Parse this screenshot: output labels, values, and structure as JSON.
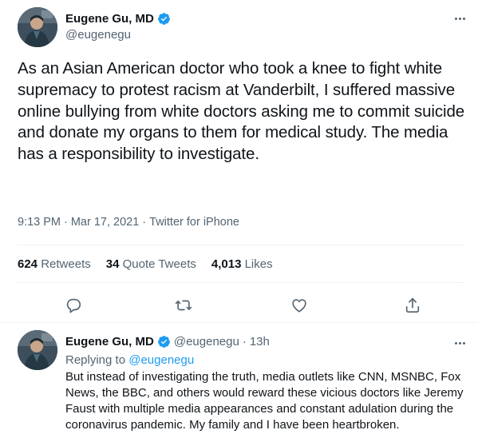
{
  "main_tweet": {
    "author": {
      "name": "Eugene Gu, MD",
      "handle": "@eugenegu",
      "verified": true
    },
    "text": "As an Asian American doctor who took a knee to fight white supremacy to protest racism at Vanderbilt, I suffered massive online bullying from white doctors asking me to commit suicide and donate my organs to them for medical study. The media has a responsibility to investigate.",
    "time": "9:13 PM",
    "date": "Mar 17, 2021",
    "separator": "·",
    "source": "Twitter for iPhone",
    "stats": {
      "retweets_count": "624",
      "retweets_label": "Retweets",
      "quote_count": "34",
      "quote_label": "Quote Tweets",
      "likes_count": "4,013",
      "likes_label": "Likes"
    },
    "actions": [
      "reply-icon",
      "retweet-icon",
      "like-icon",
      "share-icon"
    ]
  },
  "reply_tweet": {
    "author": {
      "name": "Eugene Gu, MD",
      "handle": "@eugenegu",
      "verified": true
    },
    "separator": "·",
    "age": "13h",
    "replying_prefix": "Replying to",
    "replying_to": "@eugenegu",
    "text": "But instead of investigating the truth, media outlets like CNN, MSNBC, Fox News, the BBC, and others would reward these vicious doctors like Jeremy Faust with multiple media appearances and constant adulation during the coronavirus pandemic. My family and I have been heartbroken."
  },
  "colors": {
    "text": "#0f1419",
    "secondary": "#536471",
    "accent": "#1d9bf0",
    "divider": "#eff3f4"
  }
}
